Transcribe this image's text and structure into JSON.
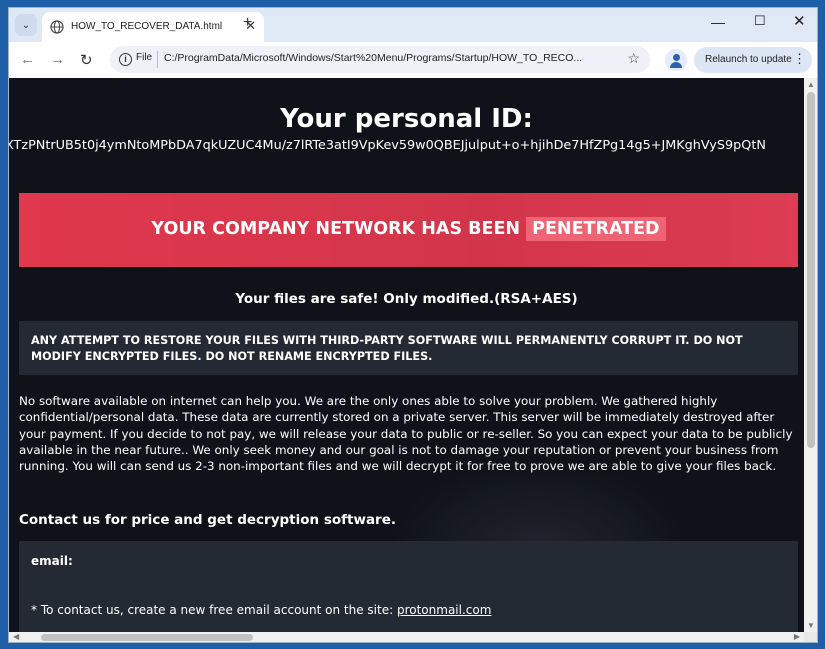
{
  "browser": {
    "tab_title": "HOW_TO_RECOVER_DATA.html",
    "address": {
      "chip_label": "File",
      "url": "C:/ProgramData/Microsoft/Windows/Start%20Menu/Programs/Startup/HOW_TO_RECO..."
    },
    "relaunch_label": "Relaunch to update"
  },
  "page": {
    "id_title": "Your personal ID:",
    "id_value": "XTzPNtrUB5t0j4ymNtoMPbDA7qkUZUC4Mu/z7lRTe3atI9VpKev59w0QBEJjulput+o+hjihDe7HfZPg14g5+JMKghVyS9pQtN",
    "banner_text": "YOUR COMPANY NETWORK HAS BEEN",
    "banner_highlight": "PENETRATED",
    "safe_line": "Your files are safe! Only modified.(RSA+AES)",
    "warning": "ANY ATTEMPT TO RESTORE YOUR FILES WITH THIRD-PARTY SOFTWARE WILL PERMANENTLY CORRUPT IT. DO NOT MODIFY ENCRYPTED FILES. DO NOT RENAME ENCRYPTED FILES.",
    "body": "No software available on internet can help you. We are the only ones able to solve your problem. We gathered highly confidential/personal data. These data are currently stored on a private server. This server will be immediately destroyed after your payment. If you decide to not pay, we will release your data to public or re-seller. So you can expect your data to be publicly available in the near future.. We only seek money and our goal is not to damage your reputation or prevent your business from running. You will can send us 2-3 non-important files and we will decrypt it for free to prove we are able to give your files back.",
    "contact_heading": "Contact us for price and get decryption software.",
    "email_label": "email:",
    "email_note_prefix": "* To contact us, create a new free email account on the site: ",
    "email_link": "protonmail.com"
  },
  "colors": {
    "banner": "#e0384d",
    "page_bg": "#0f1319",
    "box_bg": "#242a33"
  }
}
